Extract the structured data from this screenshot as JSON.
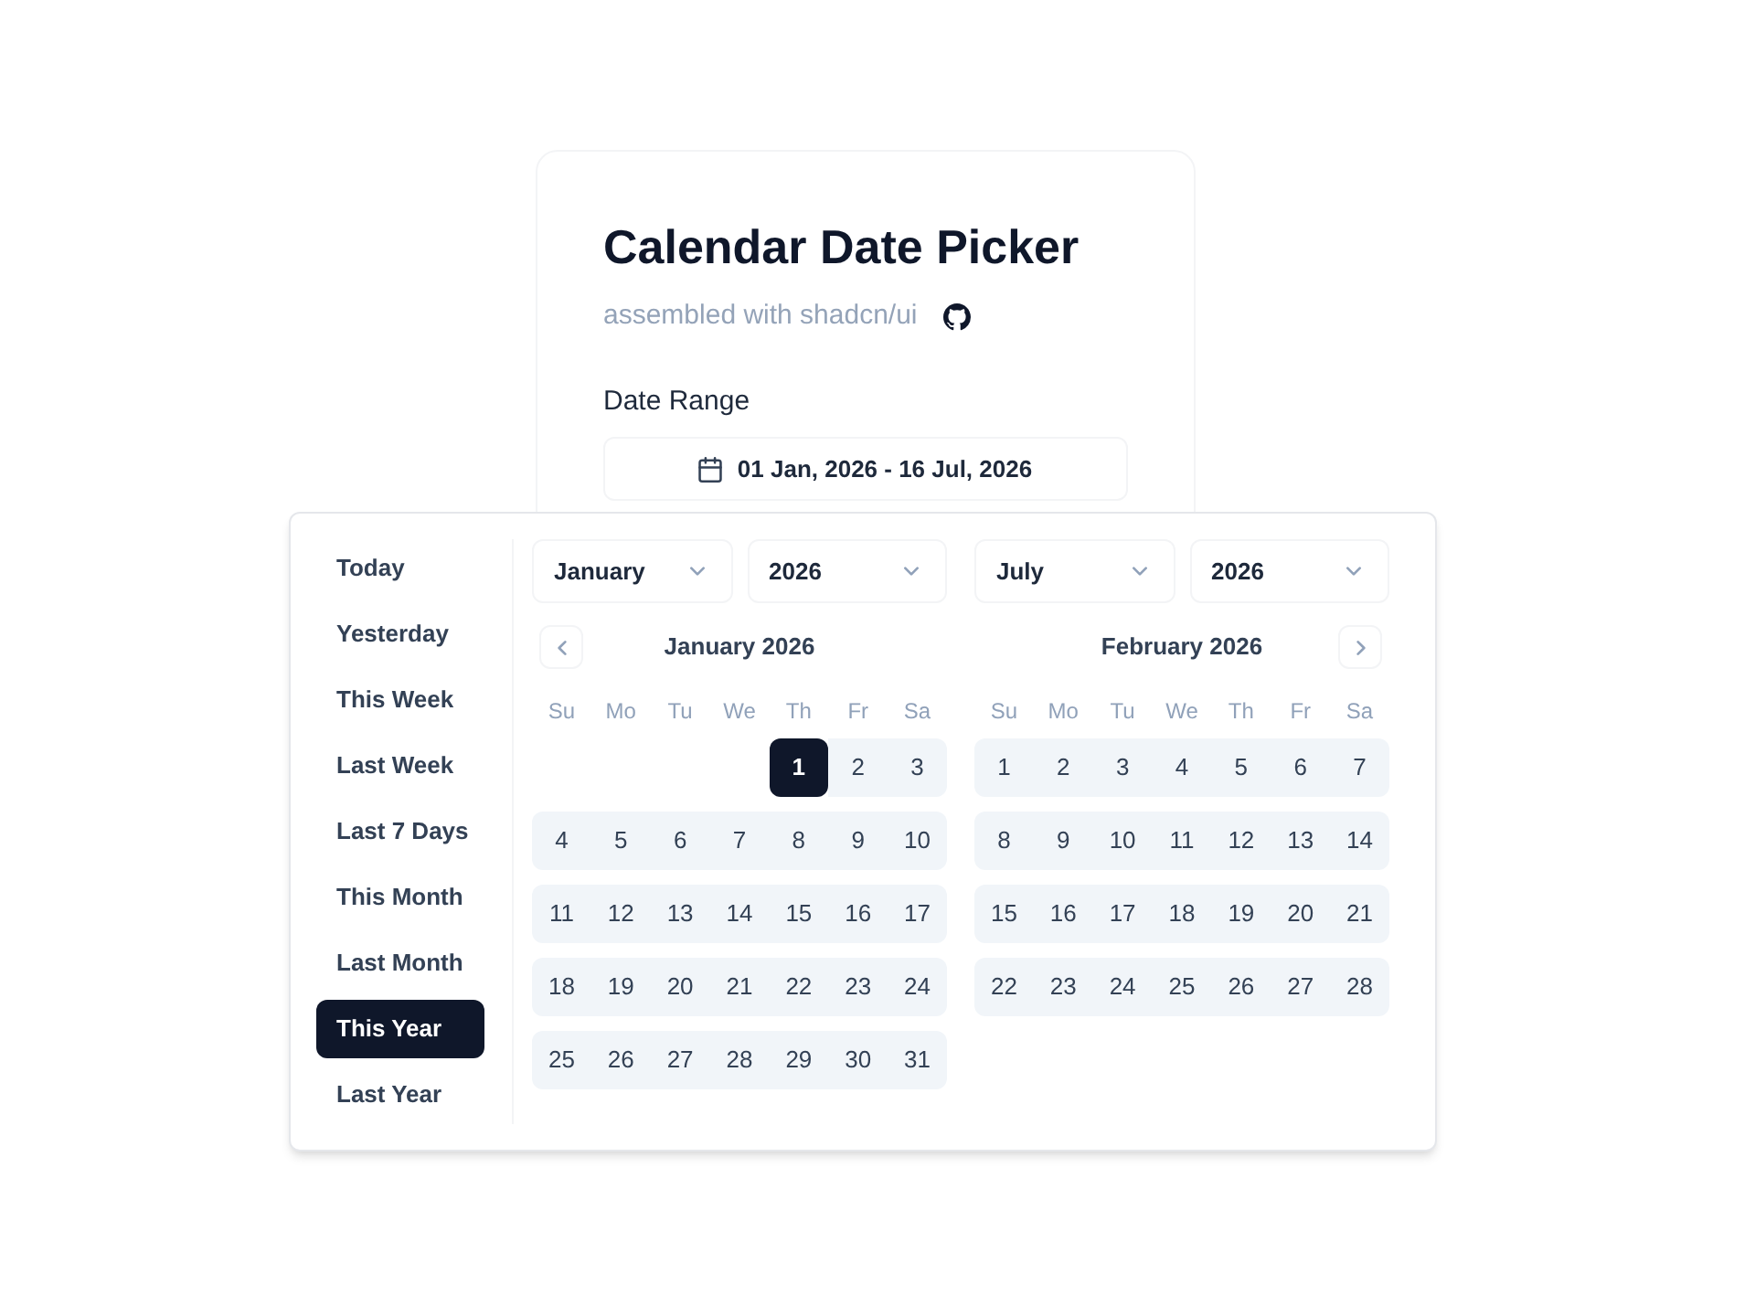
{
  "card": {
    "title": "Calendar Date Picker",
    "subtitle": "assembled with shadcn/ui",
    "field_label": "Date Range",
    "date_range": "01 Jan, 2026 - 16 Jul, 2026"
  },
  "presets": [
    {
      "label": "Today",
      "selected": false
    },
    {
      "label": "Yesterday",
      "selected": false
    },
    {
      "label": "This Week",
      "selected": false
    },
    {
      "label": "Last Week",
      "selected": false
    },
    {
      "label": "Last 7 Days",
      "selected": false
    },
    {
      "label": "This Month",
      "selected": false
    },
    {
      "label": "Last Month",
      "selected": false
    },
    {
      "label": "This Year",
      "selected": true
    },
    {
      "label": "Last Year",
      "selected": false
    }
  ],
  "months": [
    {
      "month_select": "January",
      "year_select": "2026",
      "previous_button": true,
      "title": "January 2026",
      "weekdays": [
        "Su",
        "Mo",
        "Tu",
        "We",
        "Th",
        "Fr",
        "Sa"
      ],
      "weeks": [
        {
          "kind": "partial",
          "days": [
            {
              "day": "1",
              "selected": true,
              "in_range": true
            },
            {
              "day": "2",
              "selected": false,
              "in_range": true
            },
            {
              "day": "3",
              "selected": false,
              "in_range": true
            }
          ]
        },
        {
          "kind": "full",
          "days": [
            {
              "day": "4",
              "selected": false,
              "in_range": true
            },
            {
              "day": "5",
              "selected": false,
              "in_range": true
            },
            {
              "day": "6",
              "selected": false,
              "in_range": true
            },
            {
              "day": "7",
              "selected": false,
              "in_range": true
            },
            {
              "day": "8",
              "selected": false,
              "in_range": true
            },
            {
              "day": "9",
              "selected": false,
              "in_range": true
            },
            {
              "day": "10",
              "selected": false,
              "in_range": true
            }
          ]
        },
        {
          "kind": "full",
          "days": [
            {
              "day": "11",
              "selected": false,
              "in_range": true
            },
            {
              "day": "12",
              "selected": false,
              "in_range": true
            },
            {
              "day": "13",
              "selected": false,
              "in_range": true
            },
            {
              "day": "14",
              "selected": false,
              "in_range": true
            },
            {
              "day": "15",
              "selected": false,
              "in_range": true
            },
            {
              "day": "16",
              "selected": false,
              "in_range": true
            },
            {
              "day": "17",
              "selected": false,
              "in_range": true
            }
          ]
        },
        {
          "kind": "full",
          "days": [
            {
              "day": "18",
              "selected": false,
              "in_range": true
            },
            {
              "day": "19",
              "selected": false,
              "in_range": true
            },
            {
              "day": "20",
              "selected": false,
              "in_range": true
            },
            {
              "day": "21",
              "selected": false,
              "in_range": true
            },
            {
              "day": "22",
              "selected": false,
              "in_range": true
            },
            {
              "day": "23",
              "selected": false,
              "in_range": true
            },
            {
              "day": "24",
              "selected": false,
              "in_range": true
            }
          ]
        },
        {
          "kind": "full",
          "days": [
            {
              "day": "25",
              "selected": false,
              "in_range": true
            },
            {
              "day": "26",
              "selected": false,
              "in_range": true
            },
            {
              "day": "27",
              "selected": false,
              "in_range": true
            },
            {
              "day": "28",
              "selected": false,
              "in_range": true
            },
            {
              "day": "29",
              "selected": false,
              "in_range": true
            },
            {
              "day": "30",
              "selected": false,
              "in_range": true
            },
            {
              "day": "31",
              "selected": false,
              "in_range": true
            }
          ]
        }
      ]
    },
    {
      "month_select": "July",
      "year_select": "2026",
      "next_button": true,
      "title": "February 2026",
      "weekdays": [
        "Su",
        "Mo",
        "Tu",
        "We",
        "Th",
        "Fr",
        "Sa"
      ],
      "weeks": [
        {
          "kind": "full",
          "days": [
            {
              "day": "1",
              "selected": false,
              "in_range": true
            },
            {
              "day": "2",
              "selected": false,
              "in_range": true
            },
            {
              "day": "3",
              "selected": false,
              "in_range": true
            },
            {
              "day": "4",
              "selected": false,
              "in_range": true
            },
            {
              "day": "5",
              "selected": false,
              "in_range": true
            },
            {
              "day": "6",
              "selected": false,
              "in_range": true
            },
            {
              "day": "7",
              "selected": false,
              "in_range": true
            }
          ]
        },
        {
          "kind": "full",
          "days": [
            {
              "day": "8",
              "selected": false,
              "in_range": true
            },
            {
              "day": "9",
              "selected": false,
              "in_range": true
            },
            {
              "day": "10",
              "selected": false,
              "in_range": true
            },
            {
              "day": "11",
              "selected": false,
              "in_range": true
            },
            {
              "day": "12",
              "selected": false,
              "in_range": true
            },
            {
              "day": "13",
              "selected": false,
              "in_range": true
            },
            {
              "day": "14",
              "selected": false,
              "in_range": true
            }
          ]
        },
        {
          "kind": "full",
          "days": [
            {
              "day": "15",
              "selected": false,
              "in_range": true
            },
            {
              "day": "16",
              "selected": false,
              "in_range": true
            },
            {
              "day": "17",
              "selected": false,
              "in_range": true
            },
            {
              "day": "18",
              "selected": false,
              "in_range": true
            },
            {
              "day": "19",
              "selected": false,
              "in_range": true
            },
            {
              "day": "20",
              "selected": false,
              "in_range": true
            },
            {
              "day": "21",
              "selected": false,
              "in_range": true
            }
          ]
        },
        {
          "kind": "full",
          "days": [
            {
              "day": "22",
              "selected": false,
              "in_range": true
            },
            {
              "day": "23",
              "selected": false,
              "in_range": true
            },
            {
              "day": "24",
              "selected": false,
              "in_range": true
            },
            {
              "day": "25",
              "selected": false,
              "in_range": true
            },
            {
              "day": "26",
              "selected": false,
              "in_range": true
            },
            {
              "day": "27",
              "selected": false,
              "in_range": true
            },
            {
              "day": "28",
              "selected": false,
              "in_range": true
            }
          ]
        }
      ]
    }
  ]
}
